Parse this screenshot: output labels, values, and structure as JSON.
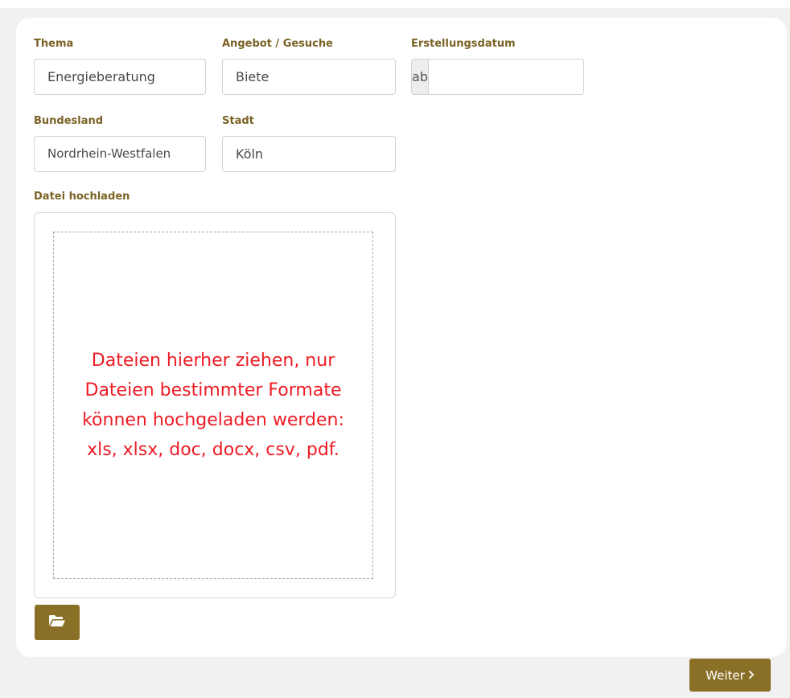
{
  "form": {
    "thema": {
      "label": "Thema",
      "value": "Energieberatung"
    },
    "angebot": {
      "label": "Angebot / Gesuche",
      "value": "Biete"
    },
    "datum": {
      "label": "Erstellungsdatum",
      "addon": "ab",
      "value": ""
    },
    "bundesland": {
      "label": "Bundesland",
      "value": "Nordrhein-Westfalen"
    },
    "stadt": {
      "label": "Stadt",
      "value": "Köln"
    }
  },
  "upload": {
    "label": "Datei hochladen",
    "dropzone_text": "Dateien hierher ziehen, nur Dateien bestimmter Formate können hochgeladen werden: xls, xlsx, doc, docx, csv, pdf.",
    "folder_icon": "folder-open-icon"
  },
  "actions": {
    "next_label": "Weiter",
    "next_icon": "chevron-right-icon"
  },
  "colors": {
    "accent": "#8a6f27",
    "label": "#7b6326",
    "drop_text": "#ee1c25",
    "background": "#f1f1f1"
  }
}
